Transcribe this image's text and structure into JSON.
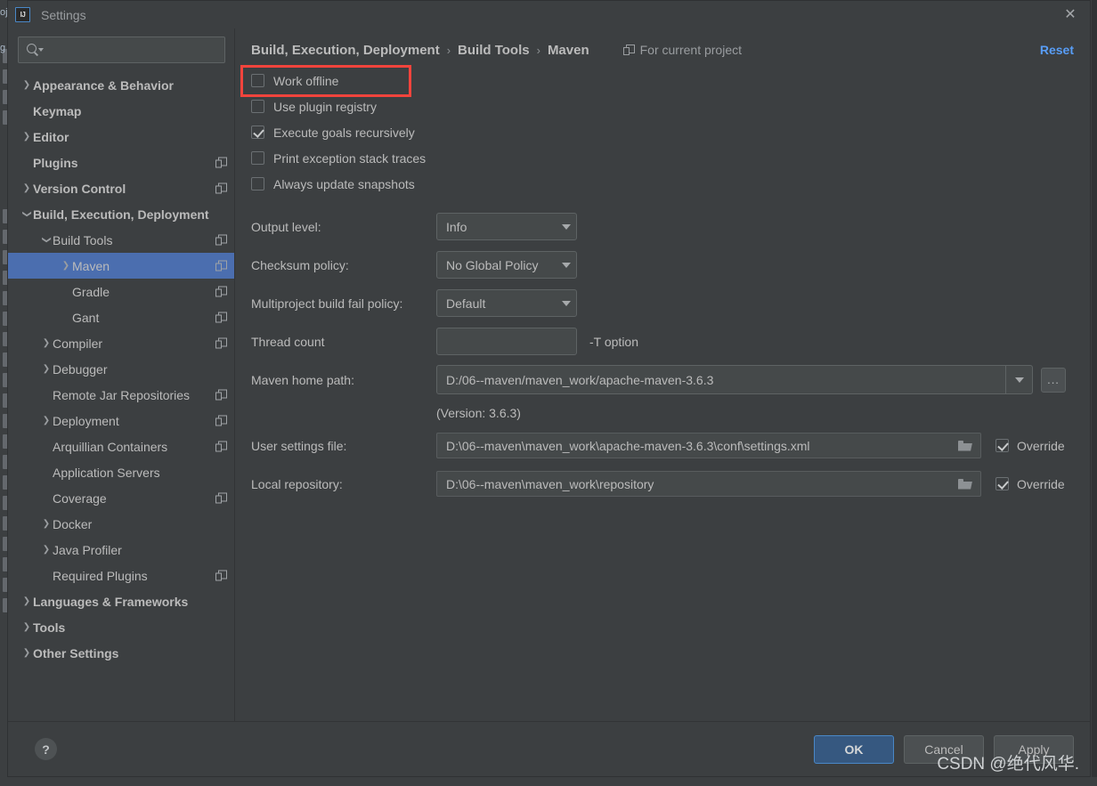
{
  "window": {
    "title": "Settings",
    "logo_text": "IJ",
    "close_icon": "close-icon"
  },
  "sidebar": {
    "search": {
      "placeholder": "",
      "value": "",
      "icon": "search-icon"
    },
    "items": [
      {
        "label": "Appearance & Behavior",
        "indent": 0,
        "arrow": "collapsed",
        "bold": true,
        "project_icon": false,
        "selected": false
      },
      {
        "label": "Keymap",
        "indent": 0,
        "arrow": "none",
        "bold": true,
        "project_icon": false,
        "selected": false
      },
      {
        "label": "Editor",
        "indent": 0,
        "arrow": "collapsed",
        "bold": true,
        "project_icon": false,
        "selected": false
      },
      {
        "label": "Plugins",
        "indent": 0,
        "arrow": "none",
        "bold": true,
        "project_icon": true,
        "selected": false
      },
      {
        "label": "Version Control",
        "indent": 0,
        "arrow": "collapsed",
        "bold": true,
        "project_icon": true,
        "selected": false
      },
      {
        "label": "Build, Execution, Deployment",
        "indent": 0,
        "arrow": "expanded",
        "bold": true,
        "project_icon": false,
        "selected": false
      },
      {
        "label": "Build Tools",
        "indent": 1,
        "arrow": "expanded",
        "bold": false,
        "project_icon": true,
        "selected": false
      },
      {
        "label": "Maven",
        "indent": 2,
        "arrow": "collapsed",
        "bold": false,
        "project_icon": true,
        "selected": true
      },
      {
        "label": "Gradle",
        "indent": 2,
        "arrow": "none",
        "bold": false,
        "project_icon": true,
        "selected": false
      },
      {
        "label": "Gant",
        "indent": 2,
        "arrow": "none",
        "bold": false,
        "project_icon": true,
        "selected": false
      },
      {
        "label": "Compiler",
        "indent": 1,
        "arrow": "collapsed",
        "bold": false,
        "project_icon": true,
        "selected": false
      },
      {
        "label": "Debugger",
        "indent": 1,
        "arrow": "collapsed",
        "bold": false,
        "project_icon": false,
        "selected": false
      },
      {
        "label": "Remote Jar Repositories",
        "indent": 1,
        "arrow": "none",
        "bold": false,
        "project_icon": true,
        "selected": false
      },
      {
        "label": "Deployment",
        "indent": 1,
        "arrow": "collapsed",
        "bold": false,
        "project_icon": true,
        "selected": false
      },
      {
        "label": "Arquillian Containers",
        "indent": 1,
        "arrow": "none",
        "bold": false,
        "project_icon": true,
        "selected": false
      },
      {
        "label": "Application Servers",
        "indent": 1,
        "arrow": "none",
        "bold": false,
        "project_icon": false,
        "selected": false
      },
      {
        "label": "Coverage",
        "indent": 1,
        "arrow": "none",
        "bold": false,
        "project_icon": true,
        "selected": false
      },
      {
        "label": "Docker",
        "indent": 1,
        "arrow": "collapsed",
        "bold": false,
        "project_icon": false,
        "selected": false
      },
      {
        "label": "Java Profiler",
        "indent": 1,
        "arrow": "collapsed",
        "bold": false,
        "project_icon": false,
        "selected": false
      },
      {
        "label": "Required Plugins",
        "indent": 1,
        "arrow": "none",
        "bold": false,
        "project_icon": true,
        "selected": false
      },
      {
        "label": "Languages & Frameworks",
        "indent": 0,
        "arrow": "collapsed",
        "bold": true,
        "project_icon": false,
        "selected": false
      },
      {
        "label": "Tools",
        "indent": 0,
        "arrow": "collapsed",
        "bold": true,
        "project_icon": false,
        "selected": false
      },
      {
        "label": "Other Settings",
        "indent": 0,
        "arrow": "collapsed",
        "bold": true,
        "project_icon": false,
        "selected": false
      }
    ]
  },
  "header": {
    "breadcrumb": [
      "Build, Execution, Deployment",
      "Build Tools",
      "Maven"
    ],
    "separator": "›",
    "scope_label": "For current project",
    "scope_icon": "project-scope-icon",
    "reset_label": "Reset",
    "reset_color": "#589df6"
  },
  "checkboxes": [
    {
      "label": "Work offline",
      "checked": false,
      "highlighted": true
    },
    {
      "label": "Use plugin registry",
      "checked": false,
      "highlighted": false
    },
    {
      "label": "Execute goals recursively",
      "checked": true,
      "highlighted": false
    },
    {
      "label": "Print exception stack traces",
      "checked": false,
      "highlighted": false
    },
    {
      "label": "Always update snapshots",
      "checked": false,
      "highlighted": false
    }
  ],
  "highlight_color": "#f4443c",
  "form": {
    "output_level": {
      "label": "Output level:",
      "value": "Info"
    },
    "checksum_policy": {
      "label": "Checksum policy:",
      "value": "No Global Policy"
    },
    "multiproject_fail_policy": {
      "label": "Multiproject build fail policy:",
      "value": "Default"
    },
    "thread_count": {
      "label": "Thread count",
      "value": "",
      "hint": "-T option"
    },
    "maven_home": {
      "label": "Maven home path:",
      "value": "D:/06--maven/maven_work/apache-maven-3.6.3",
      "browse_label": "...",
      "version_text": "(Version: 3.6.3)"
    },
    "user_settings_file": {
      "label": "User settings file:",
      "value": "D:\\06--maven\\maven_work\\apache-maven-3.6.3\\conf\\settings.xml",
      "override_label": "Override",
      "override_checked": true
    },
    "local_repository": {
      "label": "Local repository:",
      "value": "D:\\06--maven\\maven_work\\repository",
      "override_label": "Override",
      "override_checked": true
    }
  },
  "footer": {
    "help_label": "?",
    "ok_label": "OK",
    "cancel_label": "Cancel",
    "apply_label": "Apply"
  },
  "watermark": "CSDN @绝代风华.",
  "backdrop": {
    "tab_texts": [
      "oj",
      "g"
    ]
  },
  "colors": {
    "dialog_bg": "#3c3f41",
    "field_bg": "#45494a",
    "selection_blue": "#4b6eaf",
    "primary_button": "#365880",
    "text": "#bbbbbb"
  }
}
